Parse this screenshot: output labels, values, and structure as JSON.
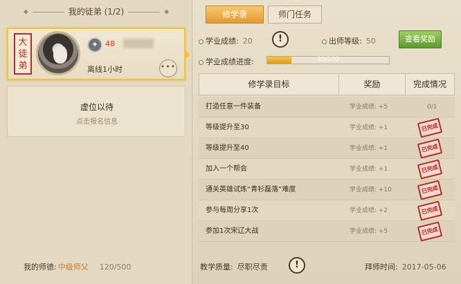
{
  "left": {
    "title": "我的徒弟 (1/2)",
    "apprentice": {
      "seal_text": "大徒弟",
      "level": "48",
      "status": "离线1小时",
      "more": "•••"
    },
    "vacant": {
      "title": "虚位以待",
      "subtitle": "点击报名信息"
    },
    "footer": {
      "label": "我的师德:",
      "rank": "中级师父",
      "points": "120/500"
    }
  },
  "tabs": [
    {
      "label": "修学录",
      "active": true
    },
    {
      "label": "师门任务",
      "active": false
    }
  ],
  "stats": {
    "score_label": "学业成绩:",
    "score_value": "20",
    "graduation_label": "出师等级:",
    "graduation_value": "50",
    "progress_label": "学业成绩进度:",
    "progress_text": "20/100",
    "progress_fraction": 0.2,
    "reward_button": "查看奖励"
  },
  "table": {
    "headers": [
      "修学录目标",
      "奖励",
      "完成情况"
    ],
    "rows": [
      {
        "goal": "打造任意一件装备",
        "reward": "学业成绩: +5",
        "status": "0/1",
        "done": false
      },
      {
        "goal": "等级提升至30",
        "reward": "学业成绩: +1",
        "status": "已完成",
        "done": true
      },
      {
        "goal": "等级提升至40",
        "reward": "学业成绩: +1",
        "status": "已完成",
        "done": true
      },
      {
        "goal": "加入一个帮会",
        "reward": "学业成绩: +1",
        "status": "已完成",
        "done": true
      },
      {
        "goal": "通关英雄试炼“青衫磊落”难度",
        "reward": "学业成绩: +10",
        "status": "已完成",
        "done": true
      },
      {
        "goal": "参与每周分享1次",
        "reward": "学业成绩: +2",
        "status": "已完成",
        "done": true
      },
      {
        "goal": "参加1次宋辽大战",
        "reward": "学业成绩: +5",
        "status": "已完成",
        "done": true
      }
    ]
  },
  "footer": {
    "teaching_label": "教学质量:",
    "teaching_value": "尽职尽责",
    "date_label": "拜师时间:",
    "date_value": "2017-05-06"
  }
}
